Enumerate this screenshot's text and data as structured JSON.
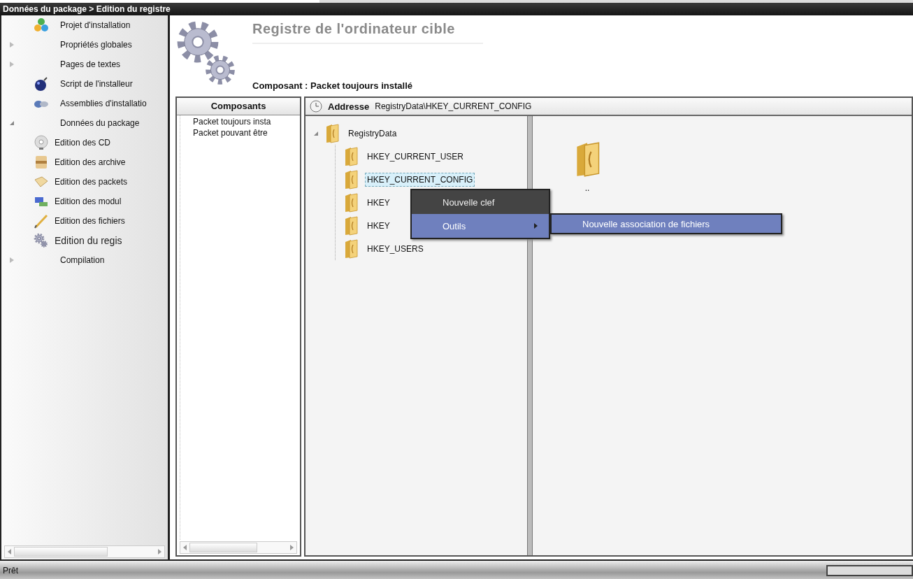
{
  "window": {
    "title": "Données du package > Edition du registre"
  },
  "sidebar": {
    "items": [
      {
        "label": "Projet d'installation",
        "selected": false
      },
      {
        "label": "Propriétés globales",
        "expanded": false,
        "selected": false
      },
      {
        "label": "Pages de textes",
        "expanded": false,
        "selected": false
      },
      {
        "label": "Script de l'installeur",
        "selected": false
      },
      {
        "label": "Assemblies  d'installatio",
        "selected": false
      },
      {
        "label": "Données du package",
        "expanded": true,
        "selected": false,
        "children": [
          {
            "label": "Edition des CD",
            "selected": false
          },
          {
            "label": "Edition des archive",
            "selected": false
          },
          {
            "label": "Edition des packets",
            "selected": false
          },
          {
            "label": "Edition des modul",
            "selected": false
          },
          {
            "label": "Edition des fichiers",
            "selected": false
          },
          {
            "label": "Edition du regis",
            "selected": true
          }
        ]
      },
      {
        "label": "Compilation",
        "expanded": false,
        "selected": false
      }
    ]
  },
  "header": {
    "title": "Registre de l'ordinateur cible",
    "subtitle": "Composant : Packet toujours installé"
  },
  "components": {
    "heading": "Composants",
    "items": [
      {
        "label": "Packet toujours insta"
      },
      {
        "label": "Packet pouvant être"
      }
    ]
  },
  "address": {
    "label": "Addresse",
    "value": "RegistryData\\HKEY_CURRENT_CONFIG"
  },
  "registry_tree": {
    "label": "RegistryData",
    "expanded": true,
    "children": [
      {
        "label": "HKEY_CURRENT_USER",
        "selected": false
      },
      {
        "label": "HKEY_CURRENT_CONFIG",
        "selected": true
      },
      {
        "label": "HKEY",
        "selected": false
      },
      {
        "label": "HKEY",
        "selected": false
      },
      {
        "label": "HKEY_USERS",
        "selected": false
      }
    ]
  },
  "file_list": {
    "items": [
      {
        "label": ".."
      }
    ]
  },
  "context_menu": {
    "items": [
      {
        "label": "Nouvelle clef",
        "selected": false,
        "has_submenu": false
      },
      {
        "label": "Outils",
        "selected": true,
        "has_submenu": true
      }
    ]
  },
  "submenu": {
    "items": [
      {
        "label": "Nouvelle association de fichiers",
        "selected": true
      }
    ]
  },
  "status_bar": {
    "text": "Prêt",
    "progress": {
      "level": 0
    }
  }
}
